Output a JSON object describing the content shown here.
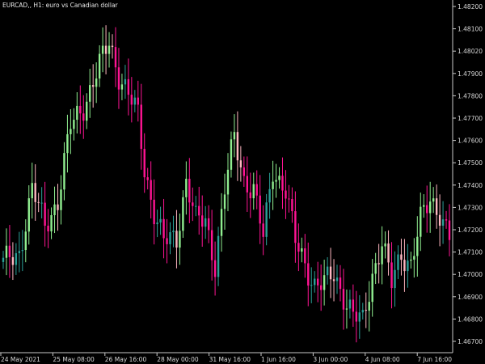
{
  "header": {
    "title": "EURCAD,, H1:  euro vs Canadian dollar"
  },
  "colors": {
    "background": "#000000",
    "axis_line": "#c8c8c8",
    "text": "#d8d8d8",
    "bull_strong": "#90ee90",
    "bull_weak": "#2aa198",
    "bear_strong": "#ff1493",
    "bear_weak": "#ffb6c1"
  },
  "chart_data": {
    "type": "bar",
    "style": "ohlc-bars",
    "symbol": "EURCAD,",
    "timeframe": "H1",
    "title": "EURCAD,, H1:  euro vs Canadian dollar",
    "ylim": [
      1.4663,
      1.4822
    ],
    "y_ticks": [
      "1.48200",
      "1.48100",
      "1.48020",
      "1.47900",
      "1.47800",
      "1.47700",
      "1.47600",
      "1.47500",
      "1.47400",
      "1.47300",
      "1.47200",
      "1.47100",
      "1.47000",
      "1.46900",
      "1.46800",
      "1.46700"
    ],
    "x_ticks": [
      "24 May 2021",
      "25 May 08:00",
      "26 May 16:00",
      "28 May 00:00",
      "31 May 16:00",
      "1 Jun 16:00",
      "3 Jun 00:00",
      "4 Jun 08:00",
      "7 Jun 16:00"
    ],
    "grid": false,
    "bar_count": 140,
    "anchors": [
      [
        0,
        1.47
      ],
      [
        5,
        1.4705
      ],
      [
        9,
        1.4735
      ],
      [
        13,
        1.4718
      ],
      [
        17,
        1.473
      ],
      [
        21,
        1.4765
      ],
      [
        25,
        1.4775
      ],
      [
        29,
        1.479
      ],
      [
        33,
        1.4805
      ],
      [
        36,
        1.479
      ],
      [
        39,
        1.478
      ],
      [
        42,
        1.477
      ],
      [
        44,
        1.4745
      ],
      [
        47,
        1.4725
      ],
      [
        50,
        1.471
      ],
      [
        54,
        1.4712
      ],
      [
        57,
        1.474
      ],
      [
        60,
        1.472
      ],
      [
        63,
        1.472
      ],
      [
        66,
        1.47
      ],
      [
        69,
        1.4735
      ],
      [
        72,
        1.476
      ],
      [
        75,
        1.474
      ],
      [
        78,
        1.4735
      ],
      [
        81,
        1.4712
      ],
      [
        84,
        1.4745
      ],
      [
        88,
        1.4735
      ],
      [
        91,
        1.471
      ],
      [
        94,
        1.47
      ],
      [
        97,
        1.469
      ],
      [
        100,
        1.469
      ],
      [
        103,
        1.4695
      ],
      [
        106,
        1.4685
      ],
      [
        109,
        1.4675
      ],
      [
        112,
        1.4672
      ],
      [
        115,
        1.4695
      ],
      [
        118,
        1.471
      ],
      [
        121,
        1.469
      ],
      [
        124,
        1.4705
      ],
      [
        127,
        1.47
      ],
      [
        130,
        1.472
      ],
      [
        133,
        1.473
      ],
      [
        136,
        1.4725
      ],
      [
        139,
        1.4712
      ]
    ]
  }
}
